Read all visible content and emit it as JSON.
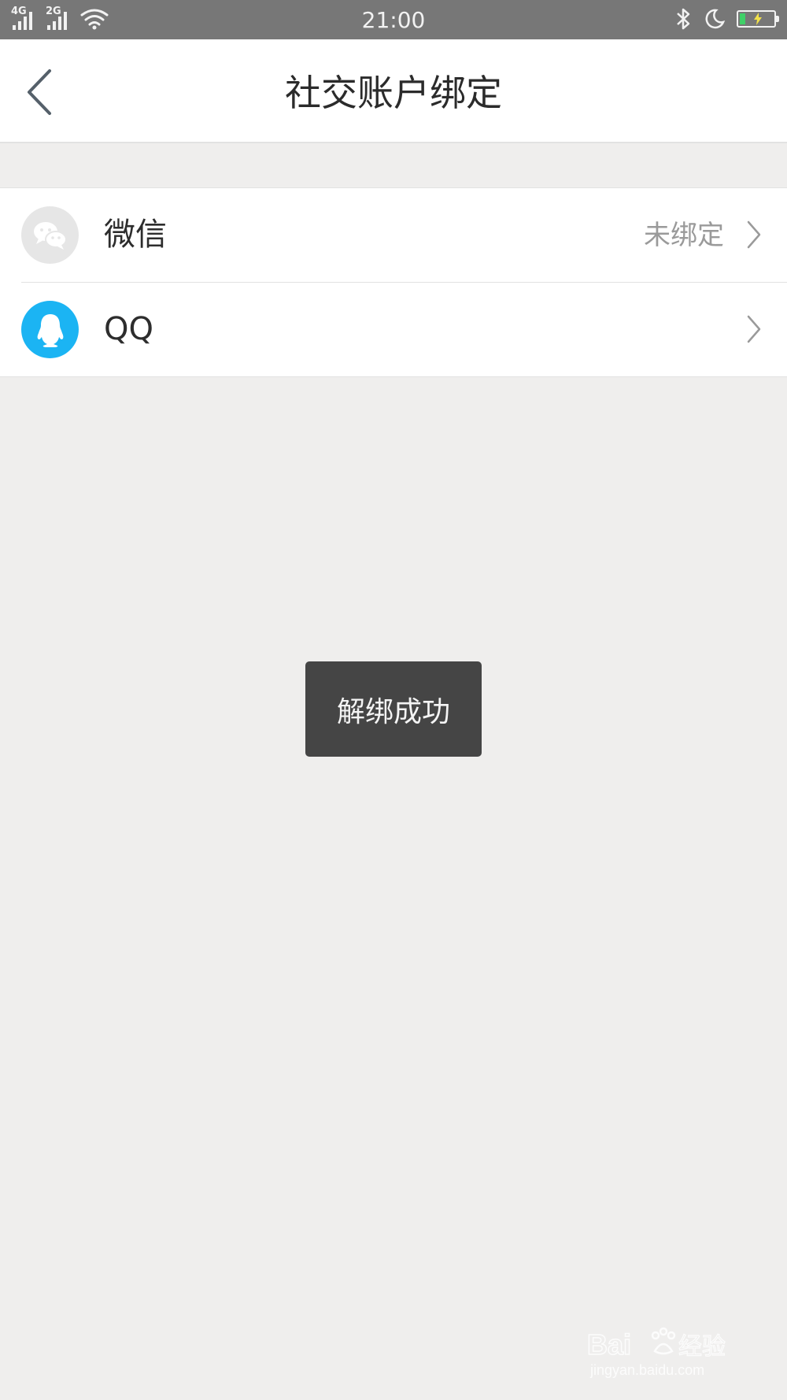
{
  "status_bar": {
    "networks": [
      "4G",
      "2G"
    ],
    "time": "21:00",
    "battery_color": "#3fd068"
  },
  "header": {
    "title": "社交账户绑定",
    "back_icon": "chevron-left-icon"
  },
  "accounts": [
    {
      "label": "微信",
      "status": "未绑定",
      "icon": "wechat-icon",
      "icon_bg": "#e6e6e6"
    },
    {
      "label": "QQ",
      "status": "",
      "icon": "qq-penguin-icon",
      "icon_bg": "#1bb4f3"
    }
  ],
  "toast": {
    "message": "解绑成功"
  },
  "watermark": {
    "brand": "Baidu经验",
    "url": "jingyan.baidu.com"
  }
}
